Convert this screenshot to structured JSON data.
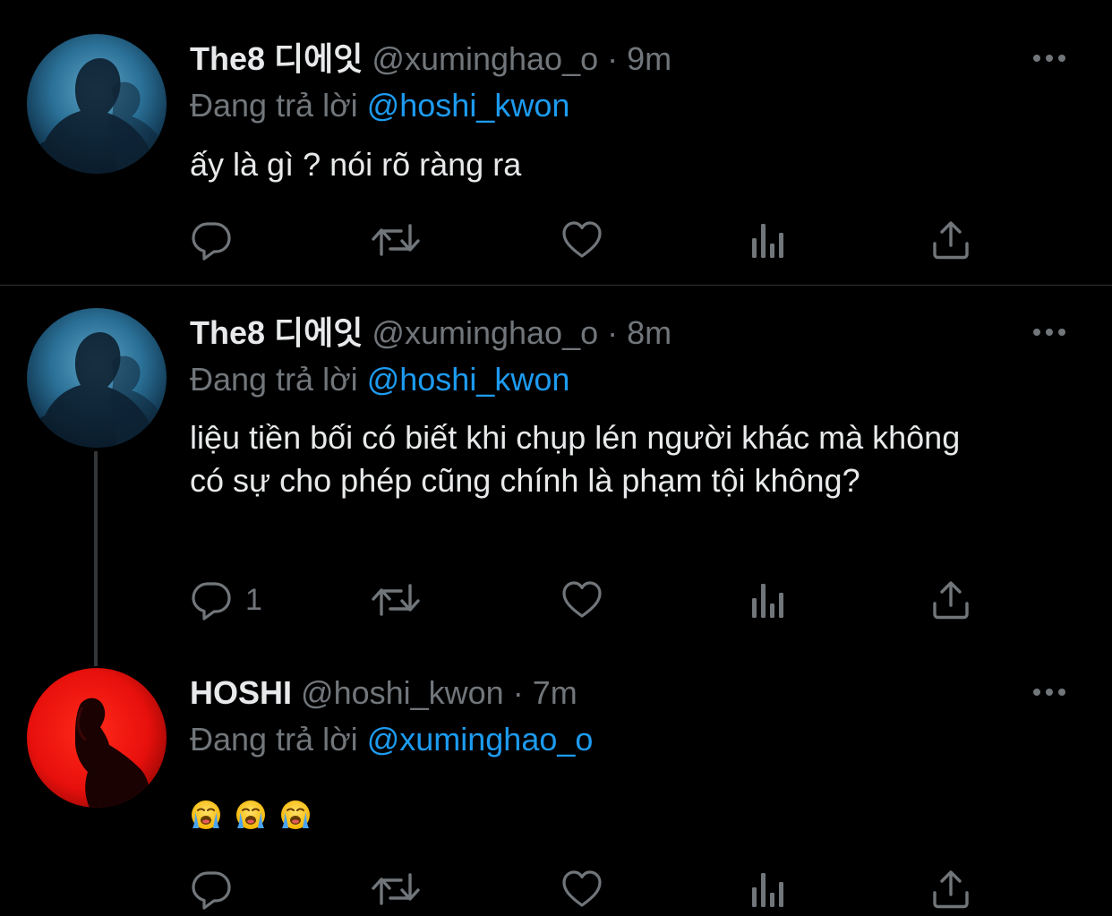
{
  "tweets": [
    {
      "display_name": "The8 디에잇",
      "handle": "@xuminghao_o",
      "separator": "·",
      "time": "9m",
      "replying_label": "Đang trả lời",
      "replying_to": "@hoshi_kwon",
      "text": "ấy là gì ? nói rõ ràng ra",
      "reply_count": ""
    },
    {
      "display_name": "The8 디에잇",
      "handle": "@xuminghao_o",
      "separator": "·",
      "time": "8m",
      "replying_label": "Đang trả lời",
      "replying_to": "@hoshi_kwon",
      "text": "liệu tiền bối có biết khi chụp lén người khác mà không có sự cho phép cũng chính là phạm tội không?",
      "reply_count": "1"
    },
    {
      "display_name": "HOSHI",
      "handle": "@hoshi_kwon",
      "separator": "·",
      "time": "7m",
      "replying_label": "Đang trả lời",
      "replying_to": "@xuminghao_o",
      "emojis": [
        "loudly-crying-face",
        "loudly-crying-face",
        "loudly-crying-face"
      ],
      "reply_count": ""
    }
  ],
  "icons": {
    "reply": "speech-bubble-icon",
    "retweet": "retweet-arrows-icon",
    "like": "heart-outline-icon",
    "analytics": "bar-chart-icon",
    "share": "share-upload-icon",
    "more": "ellipsis-icon"
  },
  "colors": {
    "background": "#000000",
    "primary_text": "#e7e9ea",
    "secondary_text": "#71767b",
    "mention": "#1d9bf0",
    "divider": "#2f3336",
    "hoshi_avatar": "#e8100c"
  }
}
